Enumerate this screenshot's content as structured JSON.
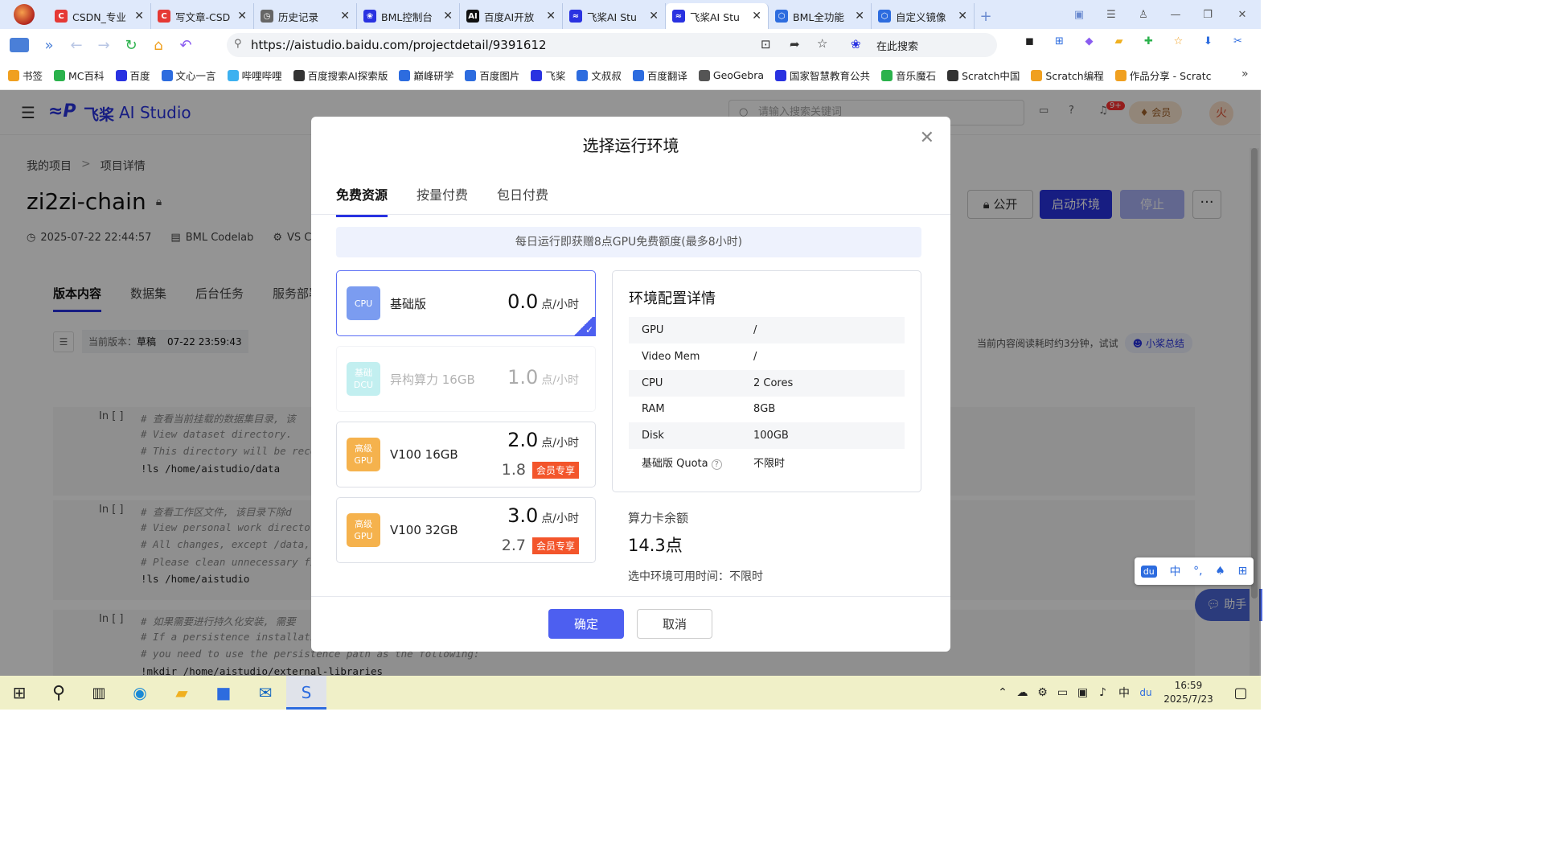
{
  "browser": {
    "tabs": [
      {
        "label": "CSDN_专业",
        "color": "#e53935",
        "glyph": "C"
      },
      {
        "label": "写文章-CSD",
        "color": "#e53935",
        "glyph": "C"
      },
      {
        "label": "历史记录",
        "color": "#666666",
        "glyph": "◷"
      },
      {
        "label": "BML控制台",
        "color": "#2932e1",
        "glyph": "❀"
      },
      {
        "label": "百度AI开放",
        "color": "#111111",
        "glyph": "AI"
      },
      {
        "label": "飞桨AI Stu",
        "color": "#2932e1",
        "glyph": "≈"
      },
      {
        "label": "飞桨AI Stu",
        "color": "#2932e1",
        "glyph": "≈"
      },
      {
        "label": "BML全功能",
        "color": "#2d6cdf",
        "glyph": "⬡"
      },
      {
        "label": "自定义镜像",
        "color": "#2d6cdf",
        "glyph": "⬡"
      }
    ],
    "url": "https://aistudio.baidu.com/projectdetail/9391612",
    "search_placeholder": "在此搜索",
    "bookmarks": [
      "书签",
      "MC百科",
      "百度",
      "文心一言",
      "哔哩哔哩",
      "百度搜索AI探索版",
      "巅峰研学",
      "百度图片",
      "飞桨",
      "文叔叔",
      "百度翻译",
      "GeoGebra",
      "国家智慧教育公共",
      "音乐魔石",
      "Scratch中国",
      "Scratch编程",
      "作品分享 - Scratc"
    ]
  },
  "app": {
    "brand": "飞桨",
    "brand_sub": "AI Studio",
    "search_placeholder": "请输入搜索关键词",
    "notif": "9+",
    "vip": "会员",
    "avatar": "火",
    "breadcrumb": [
      "我的项目",
      "项目详情"
    ],
    "crumb_sep": ">",
    "project_title": "zi2zi-chain",
    "meta_date": "2025-07-22 22:44:57",
    "meta_type": "BML Codelab",
    "meta_vs": "VS Co",
    "btn_public": "公开",
    "btn_start": "启动环境",
    "btn_stop": "停止",
    "sub_tabs": [
      "版本内容",
      "数据集",
      "后台任务",
      "服务部署"
    ],
    "version_label": "当前版本：",
    "version_value": "草稿",
    "version_time": "07-22 23:59:43",
    "read_time": "当前内容阅读耗时约3分钟，试试",
    "summary_btn": "小桨总结",
    "cells": [
      {
        "prompt": "In [ ]",
        "lines": [
          "# 查看当前挂载的数据集目录, 该",
          "# View dataset directory.",
          "# This directory will be reco",
          "!ls /home/aistudio/data"
        ]
      },
      {
        "prompt": "In [ ]",
        "lines": [
          "# 查看工作区文件, 该目录下除d",
          "# View personal work director",
          "# All changes, except /data,",
          "# Please clean unnecessary fi",
          "!ls /home/aistudio"
        ]
      },
      {
        "prompt": "In [ ]",
        "lines": [
          "# 如果需要进行持久化安装, 需要",
          "# If a persistence installati",
          "# you need to use the persistence path as the following:",
          "!mkdir /home/aistudio/external-libraries"
        ]
      }
    ],
    "assistant": "助手"
  },
  "modal": {
    "title": "选择运行环境",
    "tabs": [
      "免费资源",
      "按量付费",
      "包日付费"
    ],
    "notice": "每日运行即获赠8点GPU免费额度(最多8小时)",
    "cards": [
      {
        "badge_l1": "CPU",
        "badge_l2": "",
        "name": "基础版",
        "price": "0.0",
        "unit": "点/小时",
        "vip_price": "",
        "vip_tag": "",
        "color": "#7b9cf0",
        "selected": true,
        "disabled": false
      },
      {
        "badge_l1": "基础",
        "badge_l2": "DCU",
        "name": "异构算力 16GB",
        "price": "1.0",
        "unit": "点/小时",
        "vip_price": "",
        "vip_tag": "",
        "color": "#53d2d6",
        "selected": false,
        "disabled": true
      },
      {
        "badge_l1": "高级",
        "badge_l2": "GPU",
        "name": "V100 16GB",
        "price": "2.0",
        "unit": "点/小时",
        "vip_price": "1.8",
        "vip_tag": "会员专享",
        "color": "#f5b24d",
        "selected": false,
        "disabled": false
      },
      {
        "badge_l1": "高级",
        "badge_l2": "GPU",
        "name": "V100 32GB",
        "price": "3.0",
        "unit": "点/小时",
        "vip_price": "2.7",
        "vip_tag": "会员专享",
        "color": "#f5b24d",
        "selected": false,
        "disabled": false
      }
    ],
    "detail_title": "环境配置详情",
    "detail_rows": [
      {
        "k": "GPU",
        "v": "/"
      },
      {
        "k": "Video Mem",
        "v": "/"
      },
      {
        "k": "CPU",
        "v": "2 Cores"
      },
      {
        "k": "RAM",
        "v": "8GB"
      },
      {
        "k": "Disk",
        "v": "100GB"
      },
      {
        "k": "基础版 Quota",
        "v": "不限时"
      }
    ],
    "balance_label": "算力卡余额",
    "balance_value": "14.3点",
    "avail_label": "选中环境可用时间：",
    "avail_value": "不限时",
    "ok": "确定",
    "cancel": "取消"
  },
  "ime": [
    "中",
    "°,"
  ],
  "taskbar": {
    "time": "16:59",
    "date": "2025/7/23",
    "ime": "中"
  }
}
